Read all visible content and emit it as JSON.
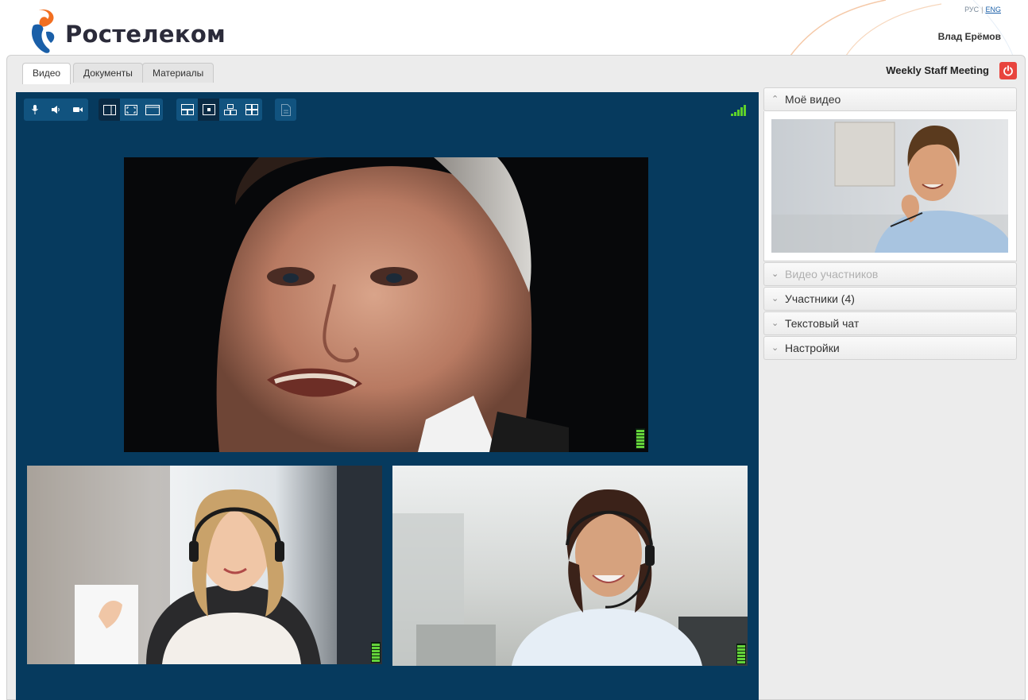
{
  "header": {
    "brand": "Ростелеком",
    "lang_ru": "РУС",
    "lang_sep": "|",
    "lang_en": "ENG",
    "user_name": "Влад Ерёмов"
  },
  "tabs": [
    {
      "label": "Видео",
      "active": true
    },
    {
      "label": "Документы",
      "active": false
    },
    {
      "label": "Материалы",
      "active": false
    }
  ],
  "meeting": {
    "title": "Weekly Staff Meeting",
    "exit_icon": "power-icon"
  },
  "toolbar": {
    "media": [
      "microphone-icon",
      "speaker-icon",
      "camera-icon"
    ],
    "view": [
      "sidebar-view-icon",
      "fullscreen-icon",
      "window-icon"
    ],
    "layout": [
      "layout-split-icon",
      "layout-single-icon",
      "layout-1plus3-icon",
      "layout-grid-icon"
    ],
    "share": [
      "share-document-icon"
    ],
    "signal_icon": "signal-strength-icon"
  },
  "videos": [
    {
      "role": "main-speaker",
      "audio_level": 1.0
    },
    {
      "role": "participant-1",
      "audio_level": 1.0
    },
    {
      "role": "participant-2",
      "audio_level": 1.0
    }
  ],
  "panel": {
    "my_video": "Моё видео",
    "participants_video": "Видео участников",
    "participants_label": "Участники",
    "participants_count": "(4)",
    "text_chat": "Текстовый чат",
    "settings": "Настройки"
  },
  "colors": {
    "brand_orange": "#f26f21",
    "brand_blue": "#1a5fa8",
    "video_bg": "#063a5e",
    "toolbar_bg": "#11537f",
    "exit_red": "#e8443d",
    "vu_green": "#64d33a"
  }
}
